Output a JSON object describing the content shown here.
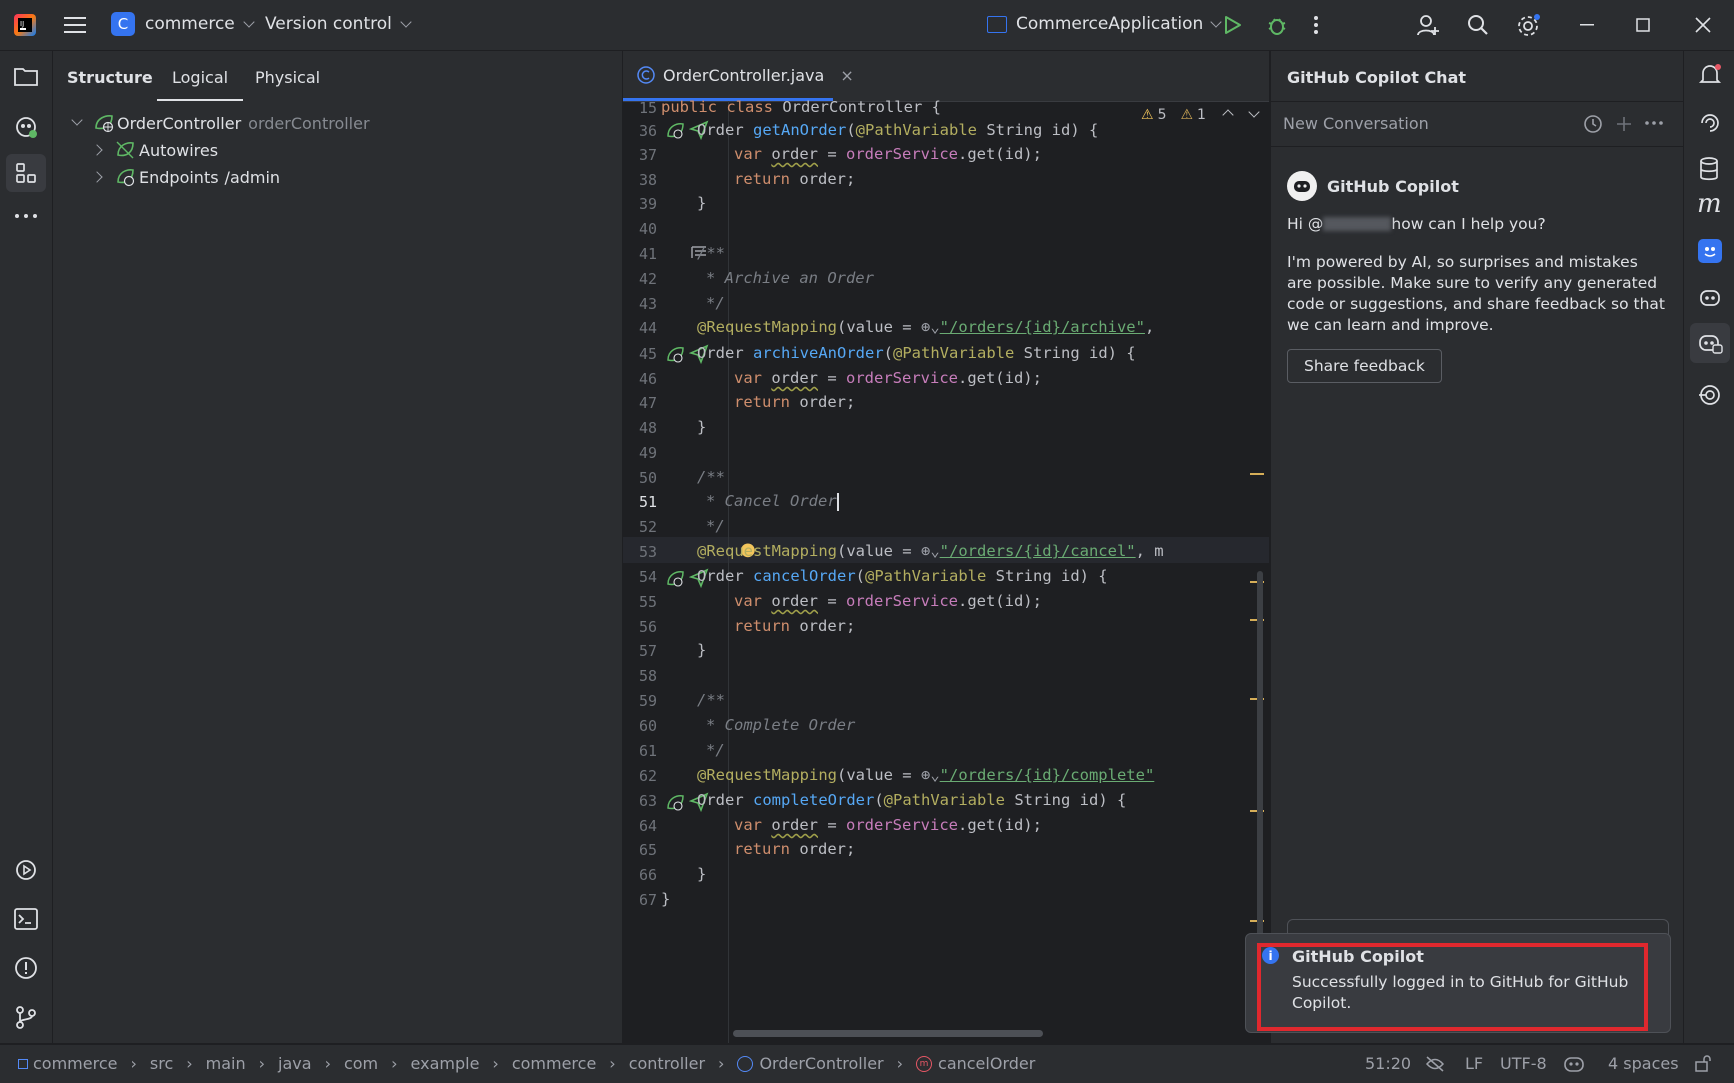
{
  "titlebar": {
    "project_initial": "C",
    "project_name": "commerce",
    "vcs_label": "Version control",
    "run_config": "CommerceApplication",
    "colors": {
      "accent": "#3574f0",
      "run": "#5fb865",
      "debug": "#5fb865"
    }
  },
  "structure": {
    "tabs": [
      "Structure",
      "Logical",
      "Physical"
    ],
    "tree": {
      "root_label": "OrderController",
      "root_hint": "orderController",
      "child1": "Autowires",
      "child2": "Endpoints",
      "child2_hint": "/admin"
    }
  },
  "editor": {
    "file_tab": "OrderController.java",
    "warnings_count": "5",
    "weak_warnings_count": "1",
    "line_numbers": [
      "15",
      "36",
      "37",
      "38",
      "39",
      "40",
      "41",
      "42",
      "43",
      "44",
      "45",
      "46",
      "47",
      "48",
      "49",
      "50",
      "51",
      "52",
      "53",
      "54",
      "55",
      "56",
      "57",
      "58",
      "59",
      "60",
      "61",
      "62",
      "63",
      "64",
      "65",
      "66",
      "67"
    ],
    "code": {
      "l15": {
        "kw": "public class ",
        "name": "OrderController {"
      },
      "l36": {
        "type": "Order ",
        "fn": "getAnOrder",
        "paren": "(",
        "ann": "@PathVariable",
        "rest": " String id) {"
      },
      "var_kw": "var ",
      "var_name": "order",
      "assign": " = ",
      "service": "orderService",
      "call": ".get(id);",
      "return_kw": "return ",
      "return_rest": "order;",
      "close_brace": "}",
      "doc_open": "/**",
      "doc_close": "*/",
      "doc_archive": "* Archive an Order",
      "doc_cancel": "* Cancel Order",
      "doc_complete": "* Complete Order",
      "req_ann": "@RequestMapping",
      "req_mid": "(value = ",
      "url_archive": "\"/orders/{id}/archive\"",
      "url_cancel": "\"/orders/{id}/cancel\"",
      "url_complete": "\"/orders/{id}/complete\"",
      "after_archive": ",",
      "after_cancel": ", m",
      "fn_archive": "archiveAnOrder",
      "fn_cancel": "cancelOrder",
      "fn_complete": "completeOrder",
      "order_type": "Order ",
      "path_var": "@PathVariable",
      "string_id": " String id) {",
      "class_close": "}"
    }
  },
  "copilot": {
    "panel_title": "GitHub Copilot Chat",
    "conversation_title": "New Conversation",
    "author": "GitHub Copilot",
    "greeting_prefix": "Hi @",
    "greeting_suffix": " how can I help you?",
    "disclaimer": "I'm powered by AI, so surprises and mistakes are possible. Make sure to verify any generated code or suggestions, and share feedback so that we can learn and improve.",
    "feedback_button": "Share feedback"
  },
  "notification": {
    "title": "GitHub Copilot",
    "message": "Successfully logged in to GitHub for GitHub Copilot."
  },
  "statusbar": {
    "breadcrumbs": [
      "commerce",
      "src",
      "main",
      "java",
      "com",
      "example",
      "commerce",
      "controller",
      "OrderController",
      "cancelOrder"
    ],
    "position": "51:20",
    "line_ending": "LF",
    "encoding": "UTF-8",
    "indent": "4 spaces"
  }
}
